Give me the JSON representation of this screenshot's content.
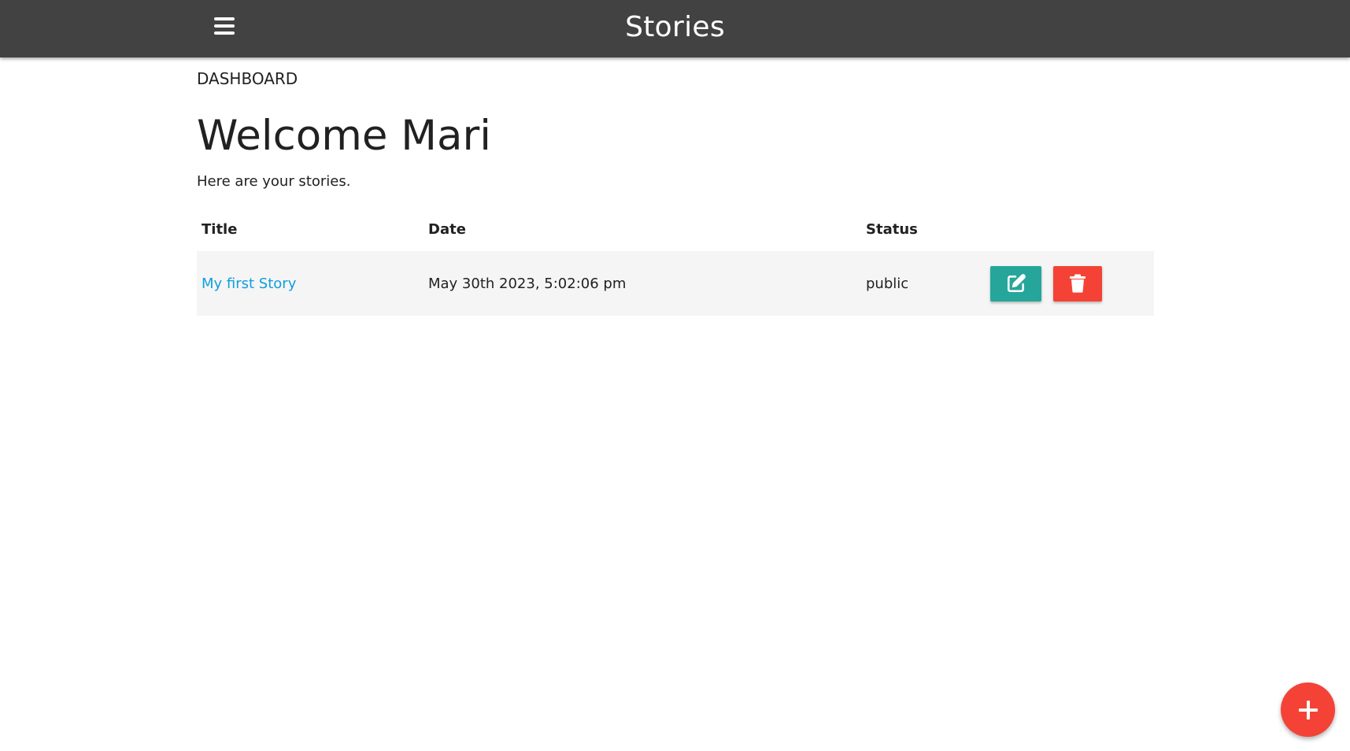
{
  "navbar": {
    "brand": "Stories",
    "menu_icon": "hamburger-menu-icon"
  },
  "dashboard": {
    "section_label": "DASHBOARD",
    "welcome": "Welcome Mari",
    "subtitle": "Here are your stories."
  },
  "table": {
    "headers": [
      "Title",
      "Date",
      "Status"
    ],
    "rows": [
      {
        "title": "My first Story",
        "date": "May 30th 2023, 5:02:06 pm",
        "status": "public",
        "edit_icon": "edit-icon",
        "delete_icon": "trash-icon"
      }
    ]
  },
  "fab": {
    "icon": "plus-icon"
  },
  "colors": {
    "navbar": "#424242",
    "link": "#0f9ee0",
    "edit_button": "#26a69a",
    "delete_button": "#f44336",
    "fab": "#f44336",
    "row_background": "#f5f5f5"
  }
}
